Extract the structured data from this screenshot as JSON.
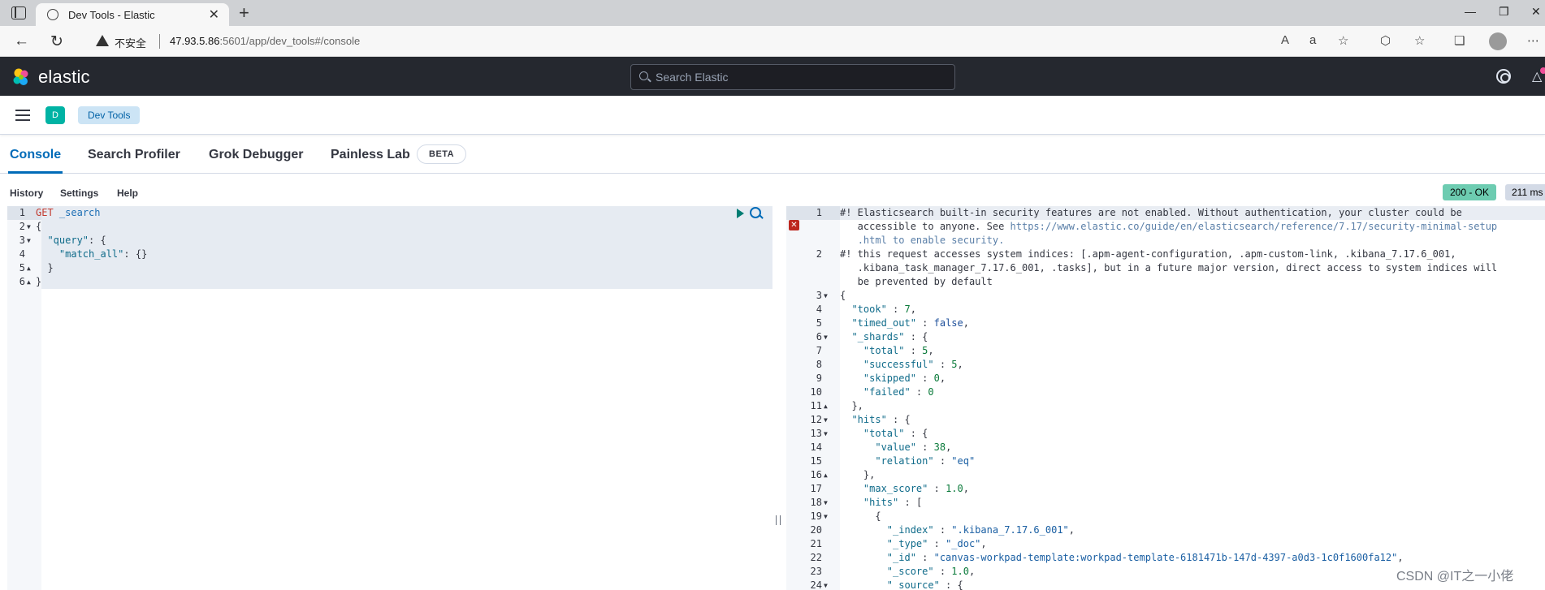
{
  "browser": {
    "tab_title": "Dev Tools - Elastic",
    "security_warning": "不安全",
    "url_host": "47.93.5.86",
    "url_rest": ":5601/app/dev_tools#/console"
  },
  "kibana": {
    "logo_text": "elastic",
    "search_placeholder": "Search Elastic"
  },
  "breadcrumbs": {
    "space_initial": "D",
    "current": "Dev Tools"
  },
  "app_tabs": [
    {
      "label": "Console",
      "active": true
    },
    {
      "label": "Search Profiler",
      "active": false
    },
    {
      "label": "Grok Debugger",
      "active": false
    },
    {
      "label": "Painless Lab",
      "active": false
    }
  ],
  "beta_label": "BETA",
  "console_menu": {
    "history": "History",
    "settings": "Settings",
    "help": "Help"
  },
  "response_status": {
    "status": "200 - OK",
    "time": "211 ms"
  },
  "request": {
    "line_numbers": [
      "1",
      "2",
      "3",
      "4",
      "5",
      "6"
    ],
    "lines": [
      "GET _search",
      "{",
      "  \"query\": {",
      "    \"match_all\": {}",
      "  }",
      "}"
    ]
  },
  "response": {
    "line_numbers": [
      "1",
      "",
      "",
      "2",
      "",
      "",
      "3",
      "4",
      "5",
      "6",
      "7",
      "8",
      "9",
      "10",
      "11",
      "12",
      "13",
      "14",
      "15",
      "16",
      "17",
      "18",
      "19",
      "20",
      "21",
      "22",
      "23",
      "24"
    ],
    "lines": [
      "#! Elasticsearch built-in security features are not enabled. Without authentication, your cluster could be",
      "   accessible to anyone. See https://www.elastic.co/guide/en/elasticsearch/reference/7.17/security-minimal-setup",
      "   .html to enable security.",
      "#! this request accesses system indices: [.apm-agent-configuration, .apm-custom-link, .kibana_7.17.6_001,",
      "   .kibana_task_manager_7.17.6_001, .tasks], but in a future major version, direct access to system indices will",
      "   be prevented by default",
      "{",
      "  \"took\" : 7,",
      "  \"timed_out\" : false,",
      "  \"_shards\" : {",
      "    \"total\" : 5,",
      "    \"successful\" : 5,",
      "    \"skipped\" : 0,",
      "    \"failed\" : 0",
      "  },",
      "  \"hits\" : {",
      "    \"total\" : {",
      "      \"value\" : 38,",
      "      \"relation\" : \"eq\"",
      "    },",
      "    \"max_score\" : 1.0,",
      "    \"hits\" : [",
      "      {",
      "        \"_index\" : \".kibana_7.17.6_001\",",
      "        \"_type\" : \"_doc\",",
      "        \"_id\" : \"canvas-workpad-template:workpad-template-6181471b-147d-4397-a0d3-1c0f1600fa12\",",
      "        \"_score\" : 1.0,",
      "        \"_source\" : {"
    ]
  },
  "watermark": "CSDN @IT之一小佬",
  "colors": {
    "header_bg": "#25282f",
    "accent": "#006bb8",
    "status_ok": "#6dccb1",
    "space_avatar": "#00b3a4"
  }
}
